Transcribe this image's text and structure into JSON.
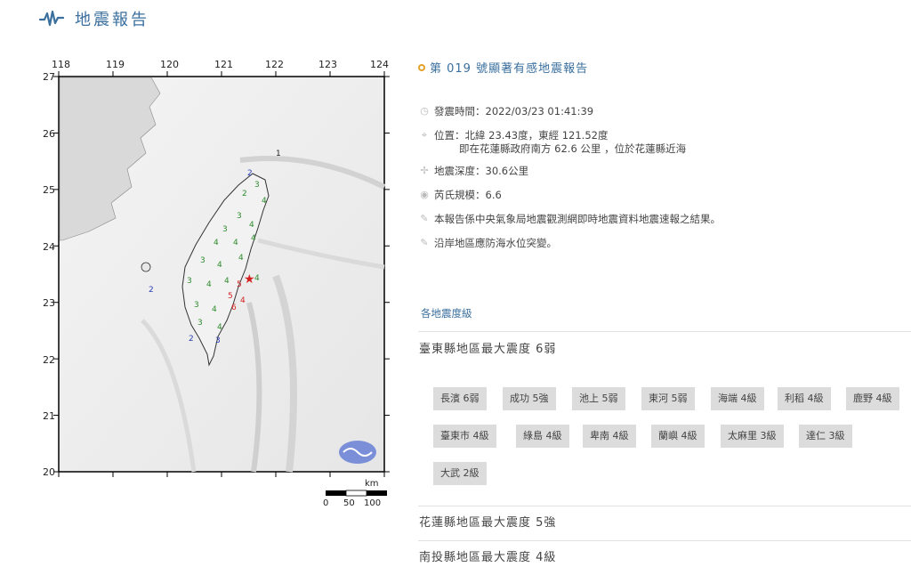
{
  "header": {
    "title": "地震報告",
    "icon": "seismograph-icon"
  },
  "map": {
    "lon_ticks": [
      "118",
      "119",
      "120",
      "121",
      "122",
      "123",
      "124"
    ],
    "lat_ticks": [
      "27",
      "26",
      "25",
      "24",
      "23",
      "22",
      "21",
      "20"
    ],
    "scale_unit": "km",
    "scale_labels": [
      "0",
      "50",
      "100"
    ],
    "offshore_label": "1"
  },
  "report": {
    "title": "第 019 號顯著有感地震報告",
    "time": "發震時間：2022/03/23 01:41:39",
    "location": "位置：北緯 23.43度，東經 121.52度",
    "location_detail": "即在花蓮縣政府南方 62.6 公里 ，位於花蓮縣近海",
    "depth": "地震深度：30.6公里",
    "magnitude": "芮氏規模：6.6",
    "note1": "本報告係中央氣象局地震觀測網即時地震資料地震速報之結果。",
    "note2": "沿岸地區應防海水位突變。"
  },
  "levels_link": "各地震度級",
  "counties": [
    {
      "title": "臺東縣地區最大震度 6弱",
      "stations": [
        "長濱 6弱",
        "成功 5強",
        "池上 5弱",
        "東河 5弱",
        "海端 4級",
        "利稻 4級",
        "鹿野 4級",
        "臺東市 4級",
        "綠島 4級",
        "卑南 4級",
        "蘭嶼 4級",
        "太麻里 3級",
        "達仁 3級",
        "大武 2級"
      ]
    },
    {
      "title": "花蓮縣地區最大震度 5強"
    },
    {
      "title": "南投縣地區最大震度 4級"
    }
  ],
  "colors": {
    "accent": "#3a6f9e",
    "marker": "#e4a12a",
    "chip_bg": "#dcdcdc"
  }
}
